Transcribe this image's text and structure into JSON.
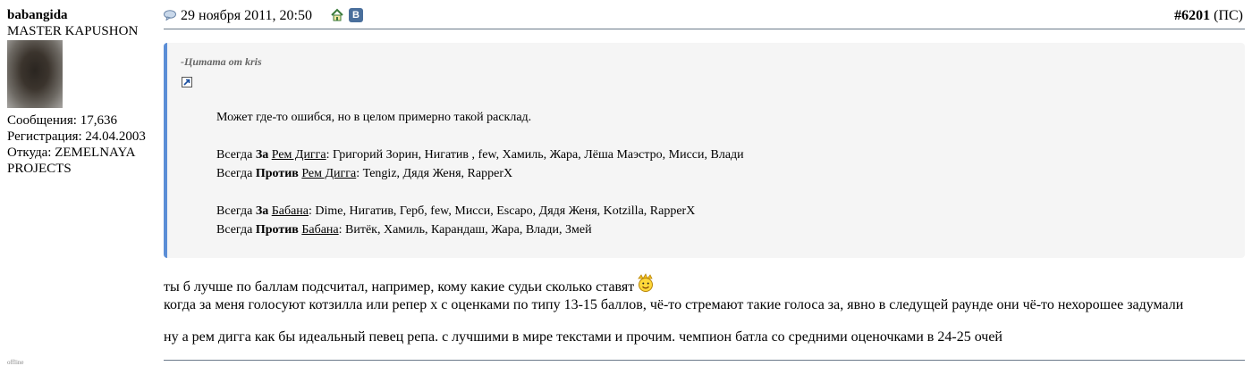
{
  "user": {
    "name": "babangida",
    "rank": "MASTER KAPUSHON",
    "stats": [
      "Сообщения: 17,636",
      "Регистрация: 24.04.2003",
      "Откуда: ZEMELNAYA PROJECTS"
    ],
    "status": "offline"
  },
  "post": {
    "date": "29 ноября 2011, 20:50",
    "number": "#6201",
    "number_suffix": " (ПС)",
    "vk_label": "В"
  },
  "quote": {
    "title": "-Цитата от kris",
    "intro": "Может где-то ошибся, но в целом примерно такой расклад.",
    "lines": [
      {
        "prefix": "Всегда ",
        "bold": "За",
        "sep": " ",
        "name": "Рем Дигга",
        "rest": ": Григорий Зорин, Нигатив , few, Хамиль, Жара, Лёша Маэстро, Мисси, Влади"
      },
      {
        "prefix": "Всегда ",
        "bold": "Против",
        "sep": " ",
        "name": "Рем Дигга",
        "rest": ": Tengiz, Дядя Женя, RapperX"
      },
      {
        "prefix": "Всегда ",
        "bold": "За",
        "sep": " ",
        "name": "Бабана",
        "rest": ": Dime, Нигатив, Герб, few, Мисси, Escapo, Дядя Женя, Kotzilla, RapperX"
      },
      {
        "prefix": "Всегда ",
        "bold": "Против",
        "sep": " ",
        "name": "Бабана",
        "rest": ": Витёк, Хамиль, Карандаш, Жара, Влади, Змей"
      }
    ]
  },
  "message": {
    "line1": "ты б лучше по баллам подсчитал, например, кому какие судьи сколько ставят",
    "line2": "когда за меня голосуют котзилла или репер х с оценками по типу 13-15 баллов, чё-то стремают такие голоса за, явно в следущей раунде они чё-то нехорошее задумали",
    "line3": "ну а рем дигга как бы идеальный певец репа. с лучшими в мире текстами и прочим. чемпион батла со средними оценочками в 24-25 очей"
  },
  "icons": {
    "post": "post-icon",
    "home": "home-icon",
    "quote_link": "link-icon",
    "smiley": "smiley-icon"
  },
  "colors": {
    "quote_accent": "#5b8ed6",
    "quote_bg": "#f5f5f5",
    "rule": "#6b7a8a"
  }
}
